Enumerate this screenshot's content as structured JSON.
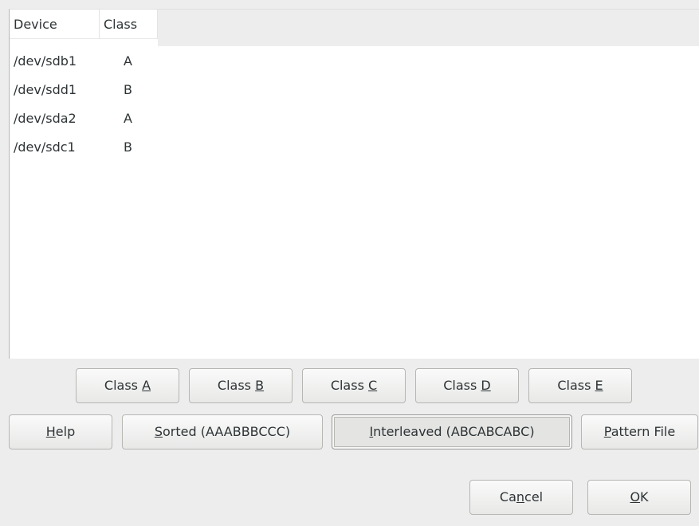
{
  "list": {
    "columns": {
      "device": "Device",
      "class": "Class"
    },
    "rows": [
      {
        "device": "/dev/sdb1",
        "class": "A"
      },
      {
        "device": "/dev/sdd1",
        "class": "B"
      },
      {
        "device": "/dev/sda2",
        "class": "A"
      },
      {
        "device": "/dev/sdc1",
        "class": "B"
      }
    ]
  },
  "class_buttons": {
    "a": {
      "prefix": "Class ",
      "mnemonic": "A",
      "suffix": ""
    },
    "b": {
      "prefix": "Class ",
      "mnemonic": "B",
      "suffix": ""
    },
    "c": {
      "prefix": "Class ",
      "mnemonic": "C",
      "suffix": ""
    },
    "d": {
      "prefix": "Class ",
      "mnemonic": "D",
      "suffix": ""
    },
    "e": {
      "prefix": "Class ",
      "mnemonic": "E",
      "suffix": ""
    }
  },
  "action_buttons": {
    "help": {
      "prefix": "",
      "mnemonic": "H",
      "suffix": "elp"
    },
    "sorted": {
      "prefix": "",
      "mnemonic": "S",
      "suffix": "orted (AAABBBCCC)"
    },
    "interleaved": {
      "prefix": "",
      "mnemonic": "I",
      "suffix": "nterleaved (ABCABCABC)"
    },
    "pattern_file": {
      "prefix": "",
      "mnemonic": "P",
      "suffix": "attern File"
    }
  },
  "dialog_buttons": {
    "cancel": {
      "prefix": "Ca",
      "mnemonic": "n",
      "suffix": "cel"
    },
    "ok": {
      "prefix": "",
      "mnemonic": "O",
      "suffix": "K"
    }
  }
}
